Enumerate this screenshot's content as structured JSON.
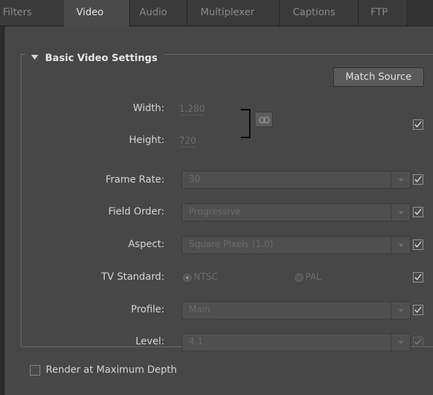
{
  "tabs": [
    {
      "label": "Filters",
      "active": false
    },
    {
      "label": "Video",
      "active": true
    },
    {
      "label": "Audio",
      "active": false
    },
    {
      "label": "Multiplexer",
      "active": false
    },
    {
      "label": "Captions",
      "active": false
    },
    {
      "label": "FTP",
      "active": false
    }
  ],
  "section": {
    "title": "Basic Video Settings",
    "match_source_label": "Match Source"
  },
  "fields": {
    "width": {
      "label": "Width:",
      "value": "1,280",
      "checked": true
    },
    "height": {
      "label": "Height:",
      "value": "720"
    },
    "frame_rate": {
      "label": "Frame Rate:",
      "value": "30",
      "checked": true
    },
    "field_order": {
      "label": "Field Order:",
      "value": "Progressive",
      "checked": true
    },
    "aspect": {
      "label": "Aspect:",
      "value": "Square Pixels (1.0)",
      "checked": true
    },
    "tv_standard": {
      "label": "TV Standard:",
      "options": [
        "NTSC",
        "PAL"
      ],
      "selected": "NTSC",
      "checked": true
    },
    "profile": {
      "label": "Profile:",
      "value": "Main",
      "checked": true
    },
    "level": {
      "label": "Level:",
      "value": "4.1",
      "checked": true
    }
  },
  "render_max_depth": {
    "label": "Render at Maximum Depth",
    "checked": false
  },
  "icons": {
    "link": "chain-link-icon",
    "dropdown": "chevron-down-icon",
    "section_toggle": "triangle-down-icon"
  },
  "colors": {
    "background": "#474747",
    "tab_bar": "#3a3a3a",
    "active_tab": "#4a4a4a",
    "disabled_text": "#6d6d6d"
  }
}
